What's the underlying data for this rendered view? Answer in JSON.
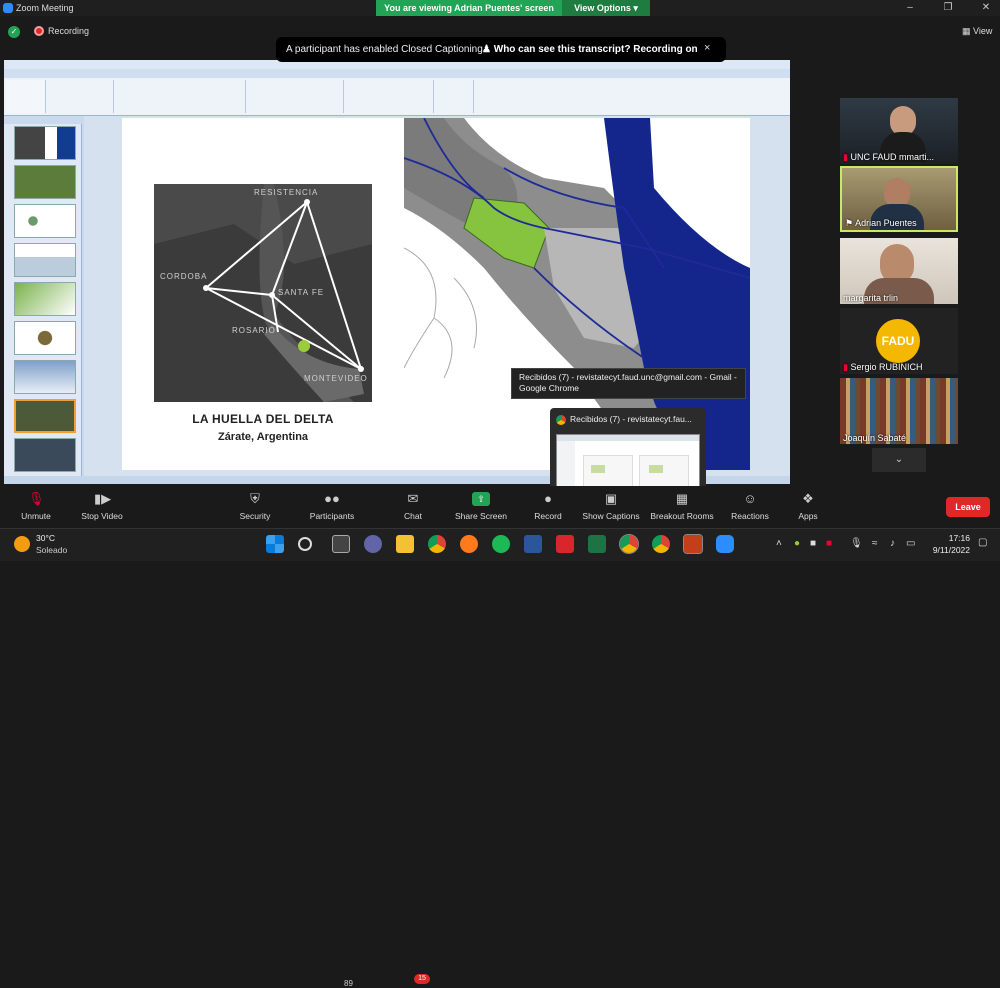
{
  "window": {
    "title": "Zoom Meeting",
    "banner": "You are viewing Adrian Puentes' screen",
    "view_options": "View Options"
  },
  "top": {
    "recording": "Recording",
    "view": "View"
  },
  "caption_notice": {
    "text": "A participant has enabled Closed Captioning",
    "link": "Who can see this transcript? Recording on",
    "close": "×"
  },
  "shared_slide": {
    "title": "LA HUELLA DEL DELTA",
    "subtitle": "Zárate, Argentina",
    "cities": [
      "RESISTENCIA",
      "CORDOBA",
      "SANTA FE",
      "ROSARIO",
      "MONTEVIDEO"
    ]
  },
  "tooltip": {
    "text": "Recibidos (7) - revistatecyt.faud.unc@gmail.com - Gmail - Google Chrome"
  },
  "chrome_preview": {
    "title": "Recibidos (7) - revistatecyt.fau..."
  },
  "participants": [
    {
      "name": "UNC FAUD mmarti..."
    },
    {
      "name": "Adrian Puentes"
    },
    {
      "name": "margarita trlin"
    },
    {
      "name": "Sergio RUBINICH",
      "avatar": "FADU"
    },
    {
      "name": "Joaquín Sabaté"
    }
  ],
  "toolbar": {
    "unmute": "Unmute",
    "stop_video": "Stop Video",
    "security": "Security",
    "participants": "Participants",
    "participants_count": "89",
    "chat": "Chat",
    "chat_badge": "15",
    "share_screen": "Share Screen",
    "record": "Record",
    "show_captions": "Show Captions",
    "breakout": "Breakout Rooms",
    "reactions": "Reactions",
    "apps": "Apps",
    "leave": "Leave"
  },
  "taskbar": {
    "temp": "30°C",
    "condition": "Soleado",
    "time": "17:16",
    "date": "9/11/2022"
  },
  "colors": {
    "zoom_green": "#23a355",
    "leave_red": "#e02828",
    "fadu_yellow": "#f5b800"
  }
}
